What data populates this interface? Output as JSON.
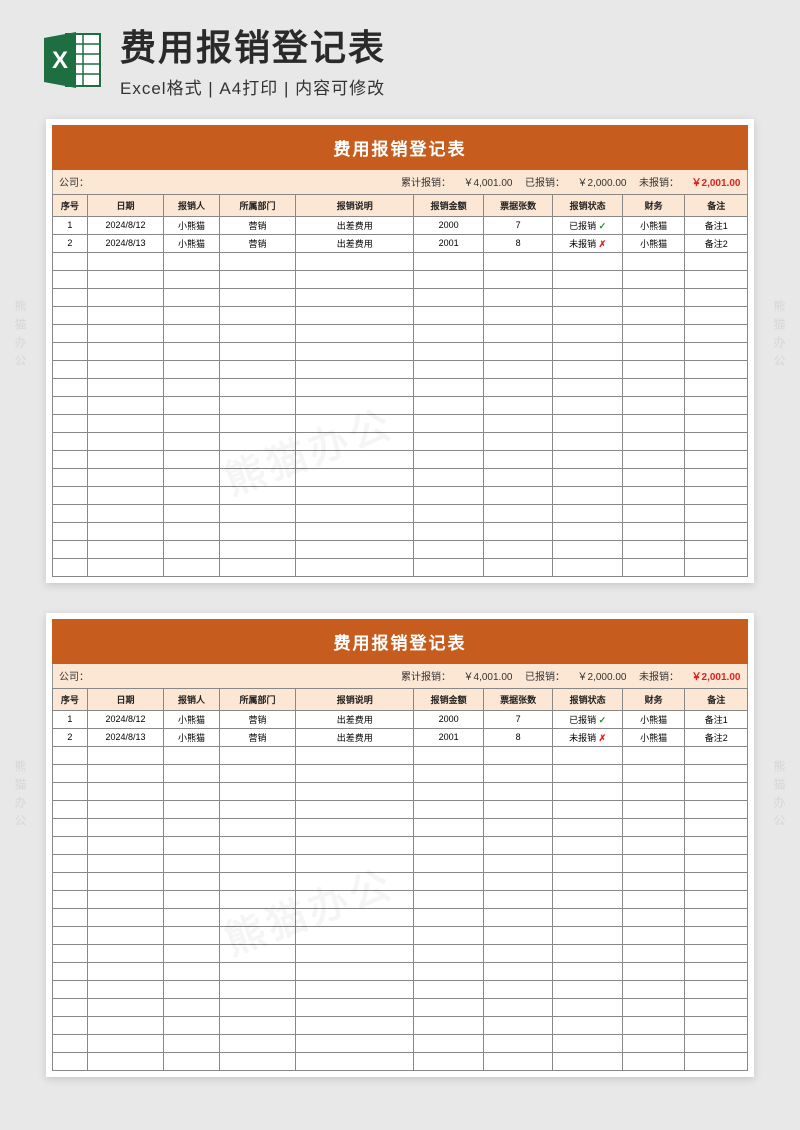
{
  "header": {
    "main_title": "费用报销登记表",
    "sub_title": "Excel格式 | A4打印 | 内容可修改",
    "excel_icon_label": "X"
  },
  "sheet": {
    "title": "费用报销登记表",
    "summary": {
      "company_label": "公司：",
      "total_label": "累计报销：",
      "total_value": "￥4,001.00",
      "reimbursed_label": "已报销：",
      "reimbursed_value": "￥2,000.00",
      "unreimbursed_label": "未报销：",
      "unreimbursed_value": "￥2,001.00"
    },
    "columns": [
      "序号",
      "日期",
      "报销人",
      "所属部门",
      "报销说明",
      "报销金额",
      "票据张数",
      "报销状态",
      "财务",
      "备注"
    ],
    "rows": [
      {
        "seq": "1",
        "date": "2024/8/12",
        "person": "小熊猫",
        "dept": "营销",
        "desc": "出差费用",
        "amount": "2000",
        "receipts": "7",
        "status": "已报销",
        "status_ok": true,
        "finance": "小熊猫",
        "note": "备注1"
      },
      {
        "seq": "2",
        "date": "2024/8/13",
        "person": "小熊猫",
        "dept": "营销",
        "desc": "出差费用",
        "amount": "2001",
        "receipts": "8",
        "status": "未报销",
        "status_ok": false,
        "finance": "小熊猫",
        "note": "备注2"
      }
    ],
    "empty_row_count": 18
  },
  "watermark": "熊猫办公",
  "side_watermark": "熊猫办公"
}
